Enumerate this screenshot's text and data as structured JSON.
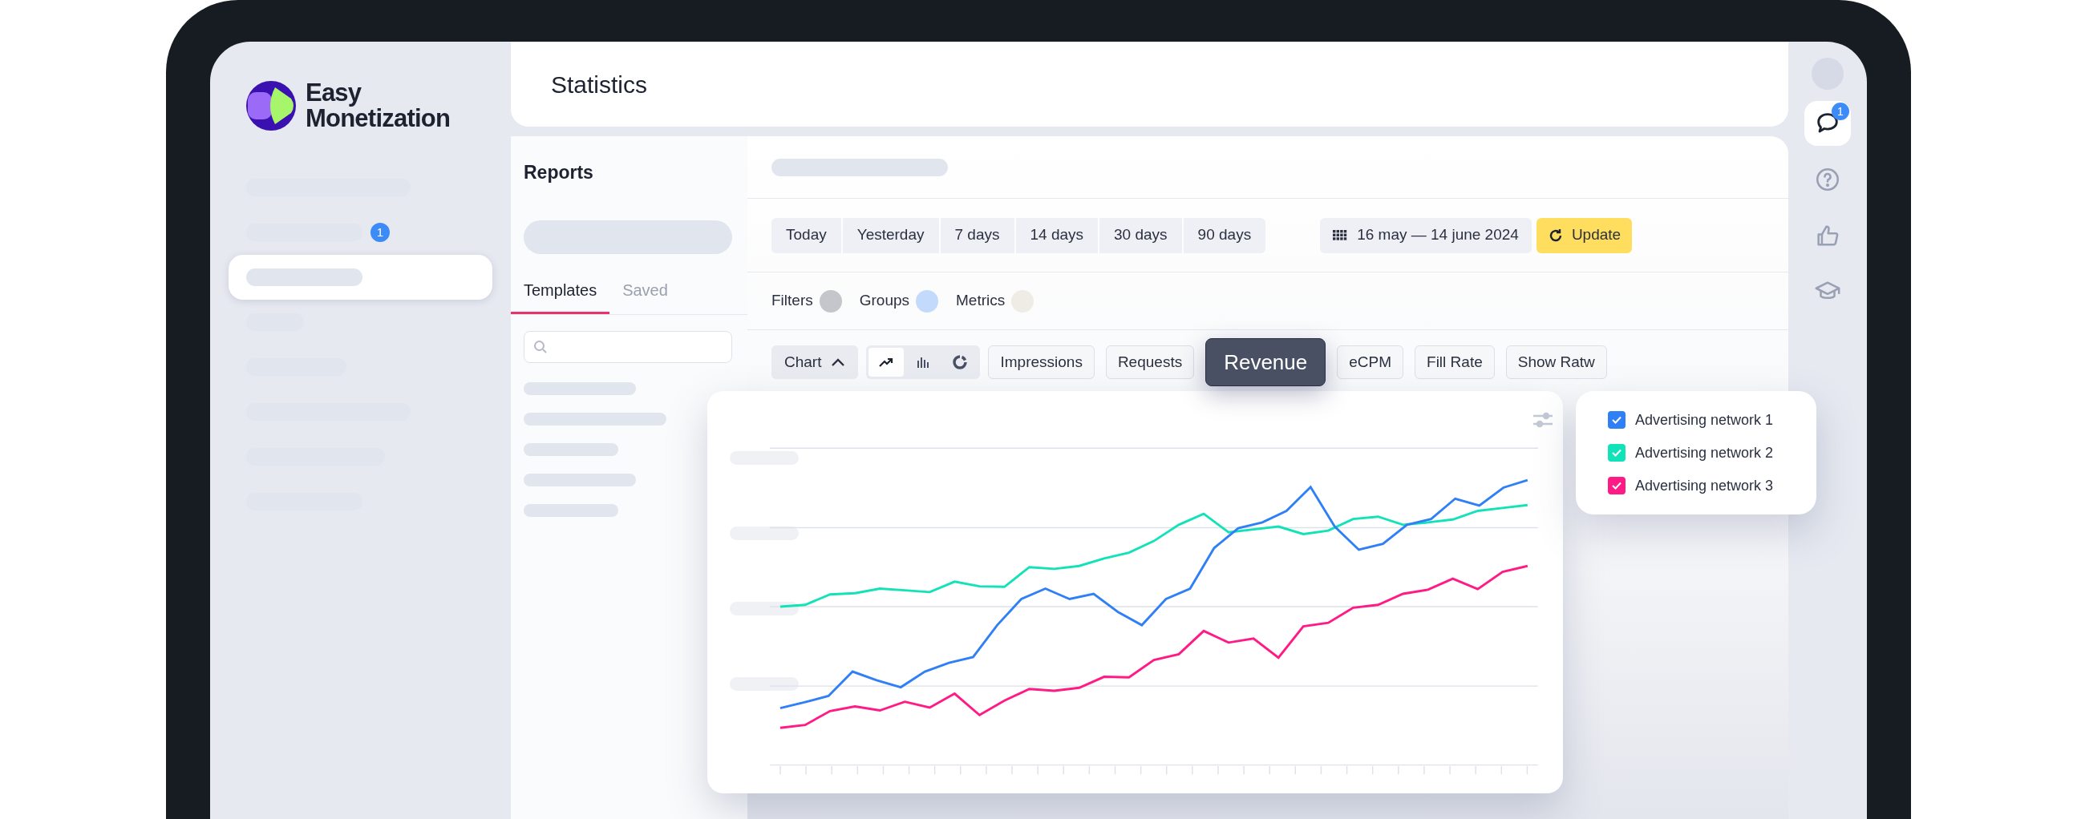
{
  "logo": {
    "line1": "Easy",
    "line2": "Monetization"
  },
  "sidebar": {
    "items": [
      {
        "selected": false
      },
      {
        "selected": false,
        "badge": "1"
      },
      {
        "selected": true
      },
      {
        "selected": false
      },
      {
        "selected": false
      },
      {
        "selected": false
      },
      {
        "selected": false
      },
      {
        "selected": false
      }
    ]
  },
  "header": {
    "title": "Statistics"
  },
  "reports": {
    "title": "Reports",
    "tabs": [
      {
        "label": "Templates",
        "selected": true
      },
      {
        "label": "Saved",
        "selected": false
      }
    ]
  },
  "periods": [
    {
      "label": "Today",
      "selected": false
    },
    {
      "label": "Yesterday",
      "selected": false
    },
    {
      "label": "7 days",
      "selected": false
    },
    {
      "label": "14 days",
      "selected": false
    },
    {
      "label": "30 days",
      "selected": false
    },
    {
      "label": "90 days",
      "selected": false
    }
  ],
  "date_range": "16 may — 14 june 2024",
  "update_button": "Update",
  "filters": [
    {
      "label": "Filters",
      "color": "#c4c6cc"
    },
    {
      "label": "Groups",
      "color": "#c3dafc"
    },
    {
      "label": "Metrics",
      "color": "#efece6"
    }
  ],
  "chart_toggle": {
    "label": "Chart",
    "expanded": true
  },
  "chart_types": [
    {
      "kind": "line",
      "selected": true
    },
    {
      "kind": "bar",
      "selected": false
    },
    {
      "kind": "donut",
      "selected": false
    }
  ],
  "metrics": [
    {
      "label": "Impressions",
      "selected": false
    },
    {
      "label": "Requests",
      "selected": false
    },
    {
      "label": "Revenue",
      "selected": true
    },
    {
      "label": "eCPM",
      "selected": false
    },
    {
      "label": "Fill Rate",
      "selected": false
    },
    {
      "label": "Show Ratw",
      "selected": false
    }
  ],
  "legend": [
    {
      "label": "Advertising network 1",
      "checked": true,
      "color": "#2f7ff7"
    },
    {
      "label": "Advertising network 2",
      "checked": true,
      "color": "#12e2b8"
    },
    {
      "label": "Advertising network 3",
      "checked": true,
      "color": "#ff1a85"
    }
  ],
  "rail": [
    {
      "kind": "chat",
      "selected": true,
      "badge": "1"
    },
    {
      "kind": "help",
      "selected": false
    },
    {
      "kind": "like",
      "selected": false
    },
    {
      "kind": "learn",
      "selected": false
    }
  ]
}
